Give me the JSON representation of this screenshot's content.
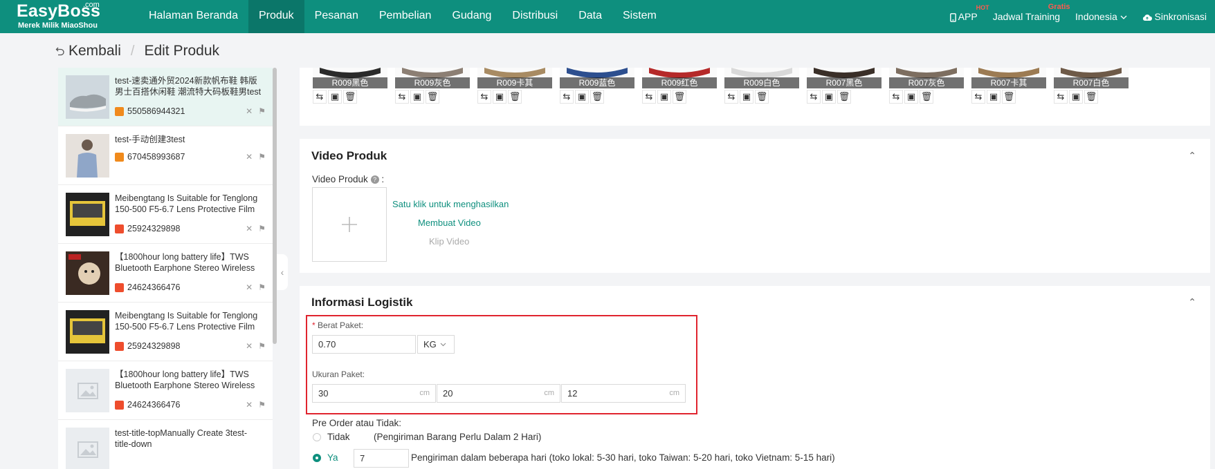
{
  "brand": {
    "name": "EasyBoss",
    "suffix": ".com",
    "tagline": "Merek Milik MiaoShou"
  },
  "nav": [
    "Halaman Beranda",
    "Produk",
    "Pesanan",
    "Pembelian",
    "Gudang",
    "Distribusi",
    "Data",
    "Sistem"
  ],
  "nav_active": "Produk",
  "top_right": {
    "app": "APP",
    "app_badge": "HOT",
    "training": "Jadwal Training",
    "training_badge": "Gratis",
    "language": "Indonesia",
    "sync": "Sinkronisasi"
  },
  "breadcrumb": {
    "back": "Kembali",
    "current": "Edit Produk"
  },
  "products": [
    {
      "title": "test-速卖通外贸2024新款帆布鞋 韩版男士百搭休闲鞋 潮流特大码板鞋男test",
      "id": "550586944321",
      "store": "orange",
      "thumb": "shoe"
    },
    {
      "title": "test-手动创建3test",
      "id": "670458993687",
      "store": "orange",
      "thumb": "person"
    },
    {
      "title": "Meibengtang Is Suitable for Tenglong 150-500 F5-6.7 Lens Protective Film ...",
      "id": "25924329898",
      "store": "red",
      "thumb": "lens"
    },
    {
      "title": "【1800hour long battery life】TWS Bluetooth Earphone Stereo Wireless ...",
      "id": "24624366476",
      "store": "red",
      "thumb": "dog"
    },
    {
      "title": "Meibengtang Is Suitable for Tenglong 150-500 F5-6.7 Lens Protective Film ...",
      "id": "25924329898",
      "store": "red",
      "thumb": "lens"
    },
    {
      "title": "【1800hour long battery life】TWS Bluetooth Earphone Stereo Wireless ...",
      "id": "24624366476",
      "store": "red",
      "thumb": "placeholder"
    },
    {
      "title": "test-title-topManually Create 3test-title-down",
      "id": "",
      "store": "",
      "thumb": "placeholder"
    }
  ],
  "variants": [
    {
      "label": "R009黑色",
      "color": "#2b2b2b"
    },
    {
      "label": "R009灰色",
      "color": "#8c7f74"
    },
    {
      "label": "R009卡其",
      "color": "#a88b63"
    },
    {
      "label": "R009蓝色",
      "color": "#2d4f8f"
    },
    {
      "label": "R009红色",
      "color": "#b52a2a"
    },
    {
      "label": "R009白色",
      "color": "#d9d9d9"
    },
    {
      "label": "R007黑色",
      "color": "#3a2f28"
    },
    {
      "label": "R007灰色",
      "color": "#7d6e60"
    },
    {
      "label": "R007卡其",
      "color": "#9c7b53"
    },
    {
      "label": "R007白色",
      "color": "#6e5a48"
    }
  ],
  "video": {
    "section_title": "Video Produk",
    "field_label": "Video Produk",
    "colon": ":",
    "link_auto": "Satu klik untuk menghasilkan",
    "link_make": "Membuat Video",
    "link_clip": "Klip Video"
  },
  "logistics": {
    "section_title": "Informasi Logistik",
    "weight_label": "Berat Paket:",
    "required_mark": "*",
    "weight_value": "0.70",
    "weight_unit": "KG",
    "size_label": "Ukuran Paket:",
    "length": "30",
    "width": "20",
    "height": "12",
    "size_unit": "cm",
    "preorder_label": "Pre Order atau Tidak:",
    "option_no": "Tidak",
    "option_no_desc": "(Pengiriman Barang Perlu Dalam 2 Hari)",
    "option_yes": "Ya",
    "days_value": "7",
    "option_yes_desc": "Pengiriman dalam beberapa hari (toko lokal: 5-30 hari, toko Taiwan: 5-20 hari, toko Vietnam: 5-15 hari)",
    "selected": "Ya"
  },
  "colors": {
    "brand": "#0e8f7e",
    "highlight": "#e0232e"
  }
}
